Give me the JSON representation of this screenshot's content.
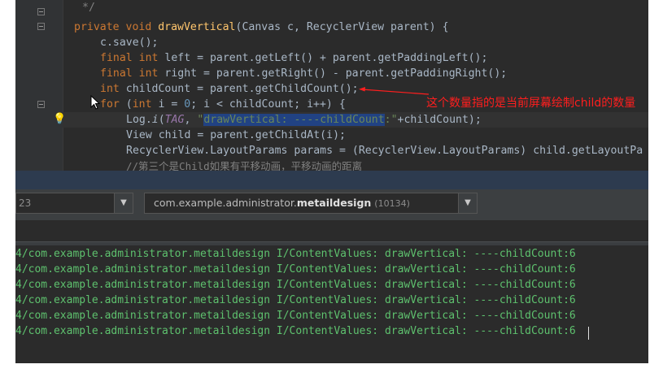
{
  "editor": {
    "line_prev_comment": "*/",
    "lines": {
      "l1": {
        "k1": "private void ",
        "fn": "drawVertical",
        "rest": "(Canvas c, RecyclerView parent) {"
      },
      "l2": {
        "rest": "c.save();"
      },
      "l3": {
        "k1": "final int ",
        "rest": "left = parent.getLeft() + parent.getPaddingLeft();"
      },
      "l4": {
        "k1": "final int ",
        "rest": "right = parent.getRight() - parent.getPaddingRight();"
      },
      "l5": {
        "k1": "int ",
        "rest": "childCount = parent.getChildCount();"
      },
      "l6": {
        "k1": "for ",
        "p1": "(",
        "k2": "int ",
        "p2": "i = ",
        "n": "0",
        "p3": "; i < childCount; i++) {"
      },
      "l7": {
        "p1": "Log.",
        "it": "i",
        "p2": "(",
        "tag": "TAG",
        "p3": ", ",
        "q1": "\"",
        "sel": "drawVertical: ----childCount",
        "q2": ":\"",
        "p4": "+childCount);"
      },
      "l8": {
        "p1": "View child = parent.getChildAt(i);"
      },
      "l9": {
        "p1": "RecyclerView.LayoutParams params = (RecyclerView.LayoutParams) child.getLayoutPa"
      },
      "l10": {
        "cmt": "//第三个是Child如果有平移动画，平移动画的距离"
      }
    }
  },
  "annotation": {
    "text": "这个数量指的是当前屏幕绘制child的数量",
    "color": "#ff1e1e"
  },
  "logcat": {
    "device_value": "23",
    "process_prefix": "com.example.administrator.",
    "process_bold": "metaildesign",
    "process_pid": "(10134)"
  },
  "log_lines": [
    "4/com.example.administrator.metaildesign I/ContentValues: drawVertical: ----childCount:6",
    "4/com.example.administrator.metaildesign I/ContentValues: drawVertical: ----childCount:6",
    "4/com.example.administrator.metaildesign I/ContentValues: drawVertical: ----childCount:6",
    "4/com.example.administrator.metaildesign I/ContentValues: drawVertical: ----childCount:6",
    "4/com.example.administrator.metaildesign I/ContentValues: drawVertical: ----childCount:6",
    "4/com.example.administrator.metaildesign I/ContentValues: drawVertical: ----childCount:6"
  ],
  "icons": [
    "lightbulb-icon",
    "mouse-cursor-icon",
    "dropdown-arrow-icon",
    "red-arrow-icon"
  ]
}
